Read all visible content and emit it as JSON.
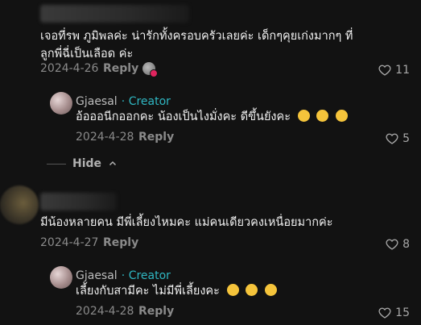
{
  "comments": [
    {
      "text": "เจอที่รพ ภูมิพลค่ะ น่ารักทั้งครอบครัวเลยค่ะ เด็กๆคุยเก่งมากๆ ที่ลูกพี่ฉี่เป็นเลือด ค่ะ",
      "date": "2024-4-26",
      "reply_label": "Reply",
      "likes": "11",
      "reply": {
        "author": "Gjaesal",
        "creator_label": "· Creator",
        "text": "อ้อออนีกออกคะ น้องเป็นไงมั่งคะ ดีขึ้นยังคะ",
        "date": "2024-4-28",
        "reply_label": "Reply",
        "likes": "5"
      },
      "hide_label": "Hide"
    },
    {
      "text": "มีน้องหลายคน มีพี่เลี้ยงไหมคะ แม่คนเดียวคงเหนื่อยมากค่ะ",
      "date": "2024-4-27",
      "reply_label": "Reply",
      "likes": "8",
      "reply": {
        "author": "Gjaesal",
        "creator_label": "· Creator",
        "text": "เลี้ยงกับสามีคะ ไม่มีพี่เลี้ยงคะ",
        "date": "2024-4-28",
        "reply_label": "Reply",
        "likes": "15"
      }
    }
  ],
  "icons": {
    "like": "heart-outline-icon",
    "hide": "chevron-up-icon"
  },
  "colors": {
    "background": "#121212",
    "creator": "#2fb7c2",
    "meta": "#8a8a8a"
  }
}
